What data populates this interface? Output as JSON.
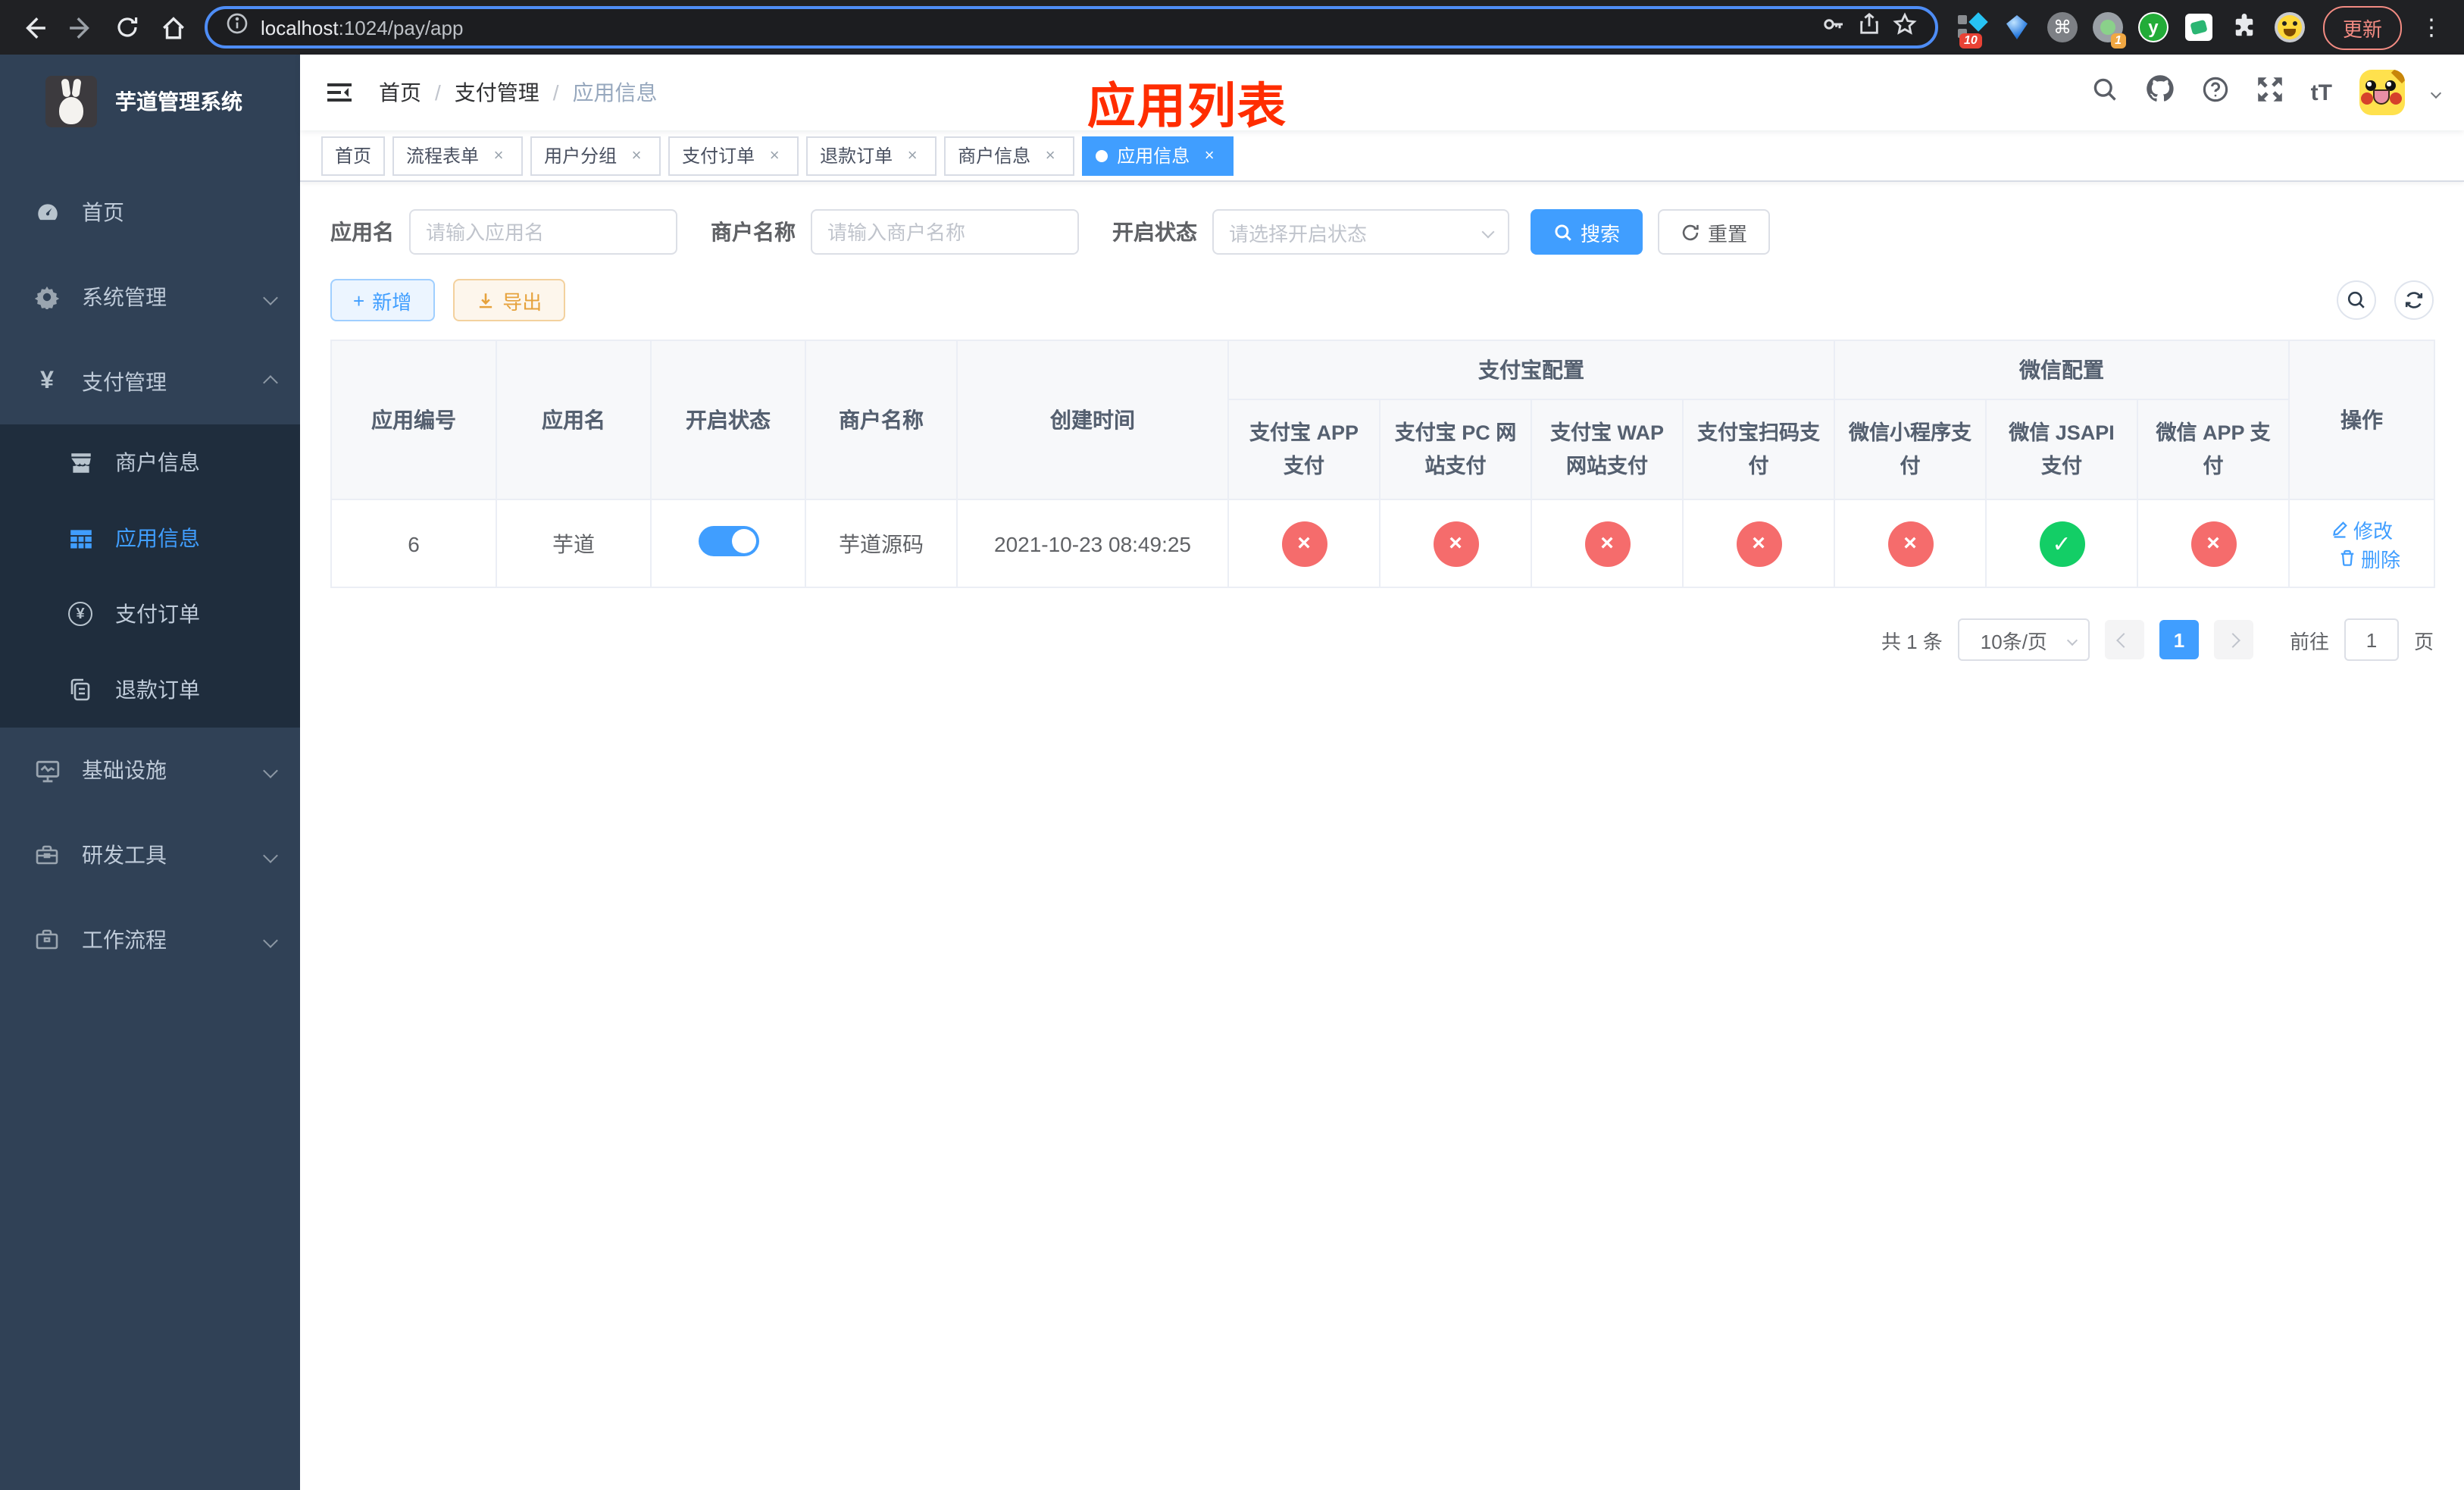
{
  "colors": {
    "accent": "#409eff",
    "success": "#13ce66",
    "danger": "#f56c6c",
    "warning": "#e6a23c",
    "sidebar_bg": "#304156",
    "submenu_bg": "#1f2d3d"
  },
  "icons": {
    "yen": "¥",
    "command": "⌘",
    "kebab": "⋮",
    "font_size": "tT",
    "plus": "+",
    "close": "×",
    "check": "✓",
    "cross": "×",
    "y_logo": "y",
    "info": "i"
  },
  "browser": {
    "url_host": "localhost",
    "url_path": ":1024/pay/app",
    "update_label": "更新",
    "ext_badge_a": "10",
    "ext_badge_b": "1"
  },
  "sidebar": {
    "title": "芋道管理系统",
    "items": [
      {
        "label": "首页"
      },
      {
        "label": "系统管理"
      },
      {
        "label": "支付管理"
      },
      {
        "label": "基础设施"
      },
      {
        "label": "研发工具"
      },
      {
        "label": "工作流程"
      }
    ],
    "submenu": [
      {
        "label": "商户信息"
      },
      {
        "label": "应用信息"
      },
      {
        "label": "支付订单"
      },
      {
        "label": "退款订单"
      }
    ]
  },
  "header": {
    "breadcrumb": [
      "首页",
      "支付管理",
      "应用信息"
    ],
    "separator": "/",
    "overlay_title": "应用列表"
  },
  "tabs": [
    {
      "label": "首页"
    },
    {
      "label": "流程表单"
    },
    {
      "label": "用户分组"
    },
    {
      "label": "支付订单"
    },
    {
      "label": "退款订单"
    },
    {
      "label": "商户信息"
    },
    {
      "label": "应用信息"
    }
  ],
  "filters": {
    "app_name_label": "应用名",
    "app_name_placeholder": "请输入应用名",
    "merchant_label": "商户名称",
    "merchant_placeholder": "请输入商户名称",
    "status_label": "开启状态",
    "status_placeholder": "请选择开启状态",
    "search_label": "搜索",
    "reset_label": "重置"
  },
  "toolbar": {
    "add_label": "新增",
    "export_label": "导出"
  },
  "table": {
    "columns": [
      "应用编号",
      "应用名",
      "开启状态",
      "商户名称",
      "创建时间"
    ],
    "groups": [
      {
        "label": "支付宝配置",
        "children": [
          "支付宝 APP 支付",
          "支付宝 PC 网站支付",
          "支付宝 WAP 网站支付",
          "支付宝扫码支付"
        ]
      },
      {
        "label": "微信配置",
        "children": [
          "微信小程序支付",
          "微信 JSAPI 支付",
          "微信 APP 支付"
        ]
      }
    ],
    "op_label": "操作",
    "row": {
      "id": "6",
      "name": "芋道",
      "enabled": true,
      "merchant": "芋道源码",
      "created": "2021-10-23 08:49:25",
      "statuses": [
        "fail",
        "fail",
        "fail",
        "fail",
        "fail",
        "ok",
        "fail"
      ],
      "edit_label": "修改",
      "delete_label": "删除"
    }
  },
  "pagination": {
    "total": "共 1 条",
    "page_size": "10条/页",
    "page": "1",
    "goto_label": "前往",
    "goto_value": "1",
    "goto_suffix": "页"
  }
}
